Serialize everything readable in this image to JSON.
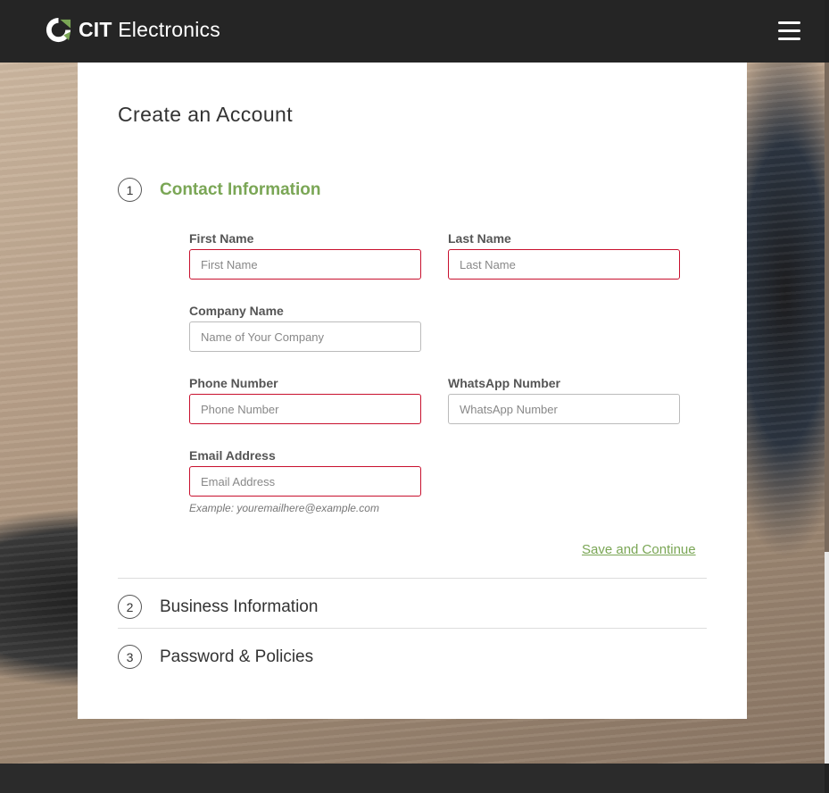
{
  "header": {
    "brand_bold": "CIT",
    "brand_rest": " Electronics",
    "logo_icon": "cit-logo-icon",
    "menu_icon": "hamburger-icon"
  },
  "form": {
    "title": "Create an Account",
    "steps": [
      {
        "number": "1",
        "label": "Contact Information",
        "active": true
      },
      {
        "number": "2",
        "label": "Business Information",
        "active": false
      },
      {
        "number": "3",
        "label": "Password & Policies",
        "active": false
      }
    ],
    "fields": {
      "first_name": {
        "label": "First Name",
        "placeholder": "First Name",
        "value": ""
      },
      "last_name": {
        "label": "Last Name",
        "placeholder": "Last Name",
        "value": ""
      },
      "company": {
        "label": "Company Name",
        "placeholder": "Name of Your Company",
        "value": ""
      },
      "phone": {
        "label": "Phone Number",
        "placeholder": "Phone Number",
        "value": ""
      },
      "whatsapp": {
        "label": "WhatsApp Number",
        "placeholder": "WhatsApp Number",
        "value": ""
      },
      "email": {
        "label": "Email Address",
        "placeholder": "Email Address",
        "value": ""
      }
    },
    "email_hint": "Example: youremailhere@example.com",
    "save_label": "Save and Continue"
  },
  "colors": {
    "accent": "#7aa655",
    "error": "#c8102e",
    "header_bg": "#252525"
  }
}
